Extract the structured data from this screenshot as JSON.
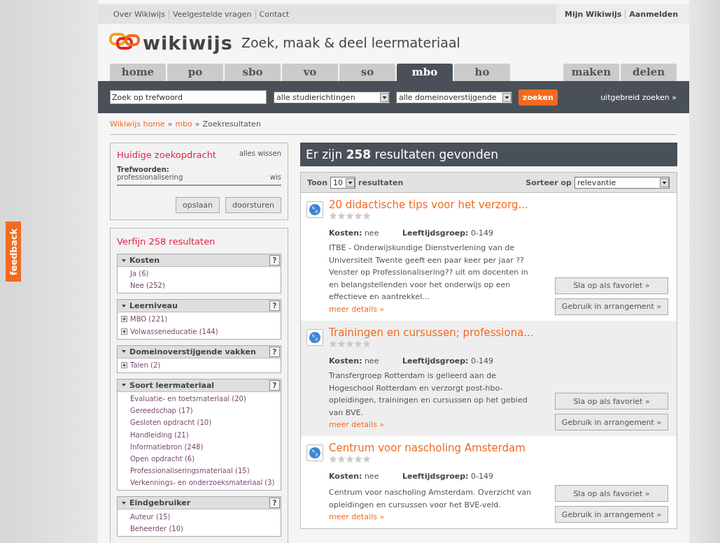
{
  "feedback": "feedback",
  "top_links": [
    "Over Wikiwijs",
    "Veelgestelde vragen",
    "Contact"
  ],
  "account_links": [
    "Mijn Wikiwijs",
    "Aanmelden"
  ],
  "logo": {
    "wordmark": "wikiwijs",
    "tagline": "Zoek, maak & deel leermateriaal"
  },
  "tabs": [
    {
      "label": "home",
      "selected": false
    },
    {
      "label": "po",
      "selected": false
    },
    {
      "label": "sbo",
      "selected": false
    },
    {
      "label": "vo",
      "selected": false
    },
    {
      "label": "so",
      "selected": false
    },
    {
      "label": "mbo",
      "selected": true
    },
    {
      "label": "ho",
      "selected": false
    }
  ],
  "side_tabs": [
    {
      "label": "maken",
      "selected": false
    },
    {
      "label": "delen",
      "selected": false
    }
  ],
  "search": {
    "placeholder": "Zoek op trefwoord",
    "filters": [
      "alle studierichtingen",
      "alle domeinoverstijgende"
    ],
    "button": "zoeken",
    "advanced": "uitgebreid zoeken »"
  },
  "breadcrumb": {
    "separator": "»",
    "items": [
      {
        "label": "Wikiwijs home",
        "link": true
      },
      {
        "label": "mbo",
        "link": true
      },
      {
        "label": "Zoekresultaten",
        "link": false
      }
    ]
  },
  "current_search": {
    "title": "Huidige zoekopdracht",
    "clear": "alles wissen",
    "keywords_label": "Trefwoorden:",
    "keyword": "professionalisering",
    "remove": "wis",
    "buttons": [
      "opslaan",
      "doorsturen"
    ]
  },
  "refine": {
    "title": "Verfijn 258 resultaten",
    "facets": [
      {
        "title": "Kosten",
        "help": "?",
        "expanded": true,
        "items": [
          {
            "label": "Ja (6)",
            "expandable": false
          },
          {
            "label": "Nee (252)",
            "expandable": false
          }
        ]
      },
      {
        "title": "Leerniveau",
        "help": "?",
        "expanded": true,
        "items": [
          {
            "label": "MBO (221)",
            "expandable": true
          },
          {
            "label": "Volwasseneducatie (144)",
            "expandable": true
          }
        ]
      },
      {
        "title": "Domeinoverstijgende vakken",
        "help": "?",
        "expanded": true,
        "items": [
          {
            "label": "Talen (2)",
            "expandable": true
          }
        ]
      },
      {
        "title": "Soort leermateriaal",
        "help": "?",
        "expanded": true,
        "items": [
          {
            "label": "Evaluatie- en toetsmateriaal (20)",
            "expandable": false
          },
          {
            "label": "Gereedschap (17)",
            "expandable": false
          },
          {
            "label": "Gesloten opdracht (10)",
            "expandable": false
          },
          {
            "label": "Handleiding (21)",
            "expandable": false
          },
          {
            "label": "Informatiebron (248)",
            "expandable": false
          },
          {
            "label": "Open opdracht (6)",
            "expandable": false
          },
          {
            "label": "Professionaliseringsmateriaal (15)",
            "expandable": false
          },
          {
            "label": "Verkennings- en onderzoeksmateriaal (3)",
            "expandable": false
          }
        ]
      },
      {
        "title": "Eindgebruiker",
        "help": "?",
        "expanded": true,
        "items": [
          {
            "label": "Auteur (15)",
            "expandable": false
          },
          {
            "label": "Beheerder (10)",
            "expandable": false
          }
        ]
      }
    ]
  },
  "results_header": "Er zijn **258** resultaten gevonden",
  "toolbar": {
    "show_label": "Toon",
    "per_page": "10",
    "results_label": "resultaten",
    "sort_label": "Sorteer op",
    "sort": "relevantie"
  },
  "results": [
    {
      "title": "20 didactische tips voor het verzorg...",
      "stars": 0,
      "shaded": false,
      "cost_label": "Kosten:",
      "cost": "nee",
      "age_label": "Leeftijdsgroep:",
      "age": "0-149",
      "description": "ITBE - Onderwijskundige Dienstverlening van de Universiteit Twente geeft een paar keer per jaar ?? Venster op Professionalisering?? uit om docenten in en belangstellenden voor het onderwijs op een effectieve en aantrekkel...",
      "more": "meer details »",
      "actions": [
        "Sla op als favoriet »",
        "Gebruik in arrangement »"
      ]
    },
    {
      "title": "Trainingen en cursussen; professiona...",
      "stars": 0,
      "shaded": true,
      "cost_label": "Kosten:",
      "cost": "nee",
      "age_label": "Leeftijdsgroep:",
      "age": "0-149",
      "description": "Transfergroep Rotterdam is gelieerd aan de Hogeschool Rotterdam en verzorgt post-hbo-opleidingen, trainingen en cursussen op het gebied van BVE.",
      "more": "meer details »",
      "actions": [
        "Sla op als favoriet »",
        "Gebruik in arrangement »"
      ]
    },
    {
      "title": "Centrum voor nascholing Amsterdam",
      "stars": 0,
      "shaded": false,
      "cost_label": "Kosten:",
      "cost": "nee",
      "age_label": "Leeftijdsgroep:",
      "age": "0-149",
      "description": "Centrum voor nascholing Amsterdam. Overzicht van opleidingen en cursussen voor het BVE-veld.",
      "more": "meer details »",
      "actions": [
        "Sla op als favoriet »",
        "Gebruik in arrangement »"
      ]
    }
  ]
}
